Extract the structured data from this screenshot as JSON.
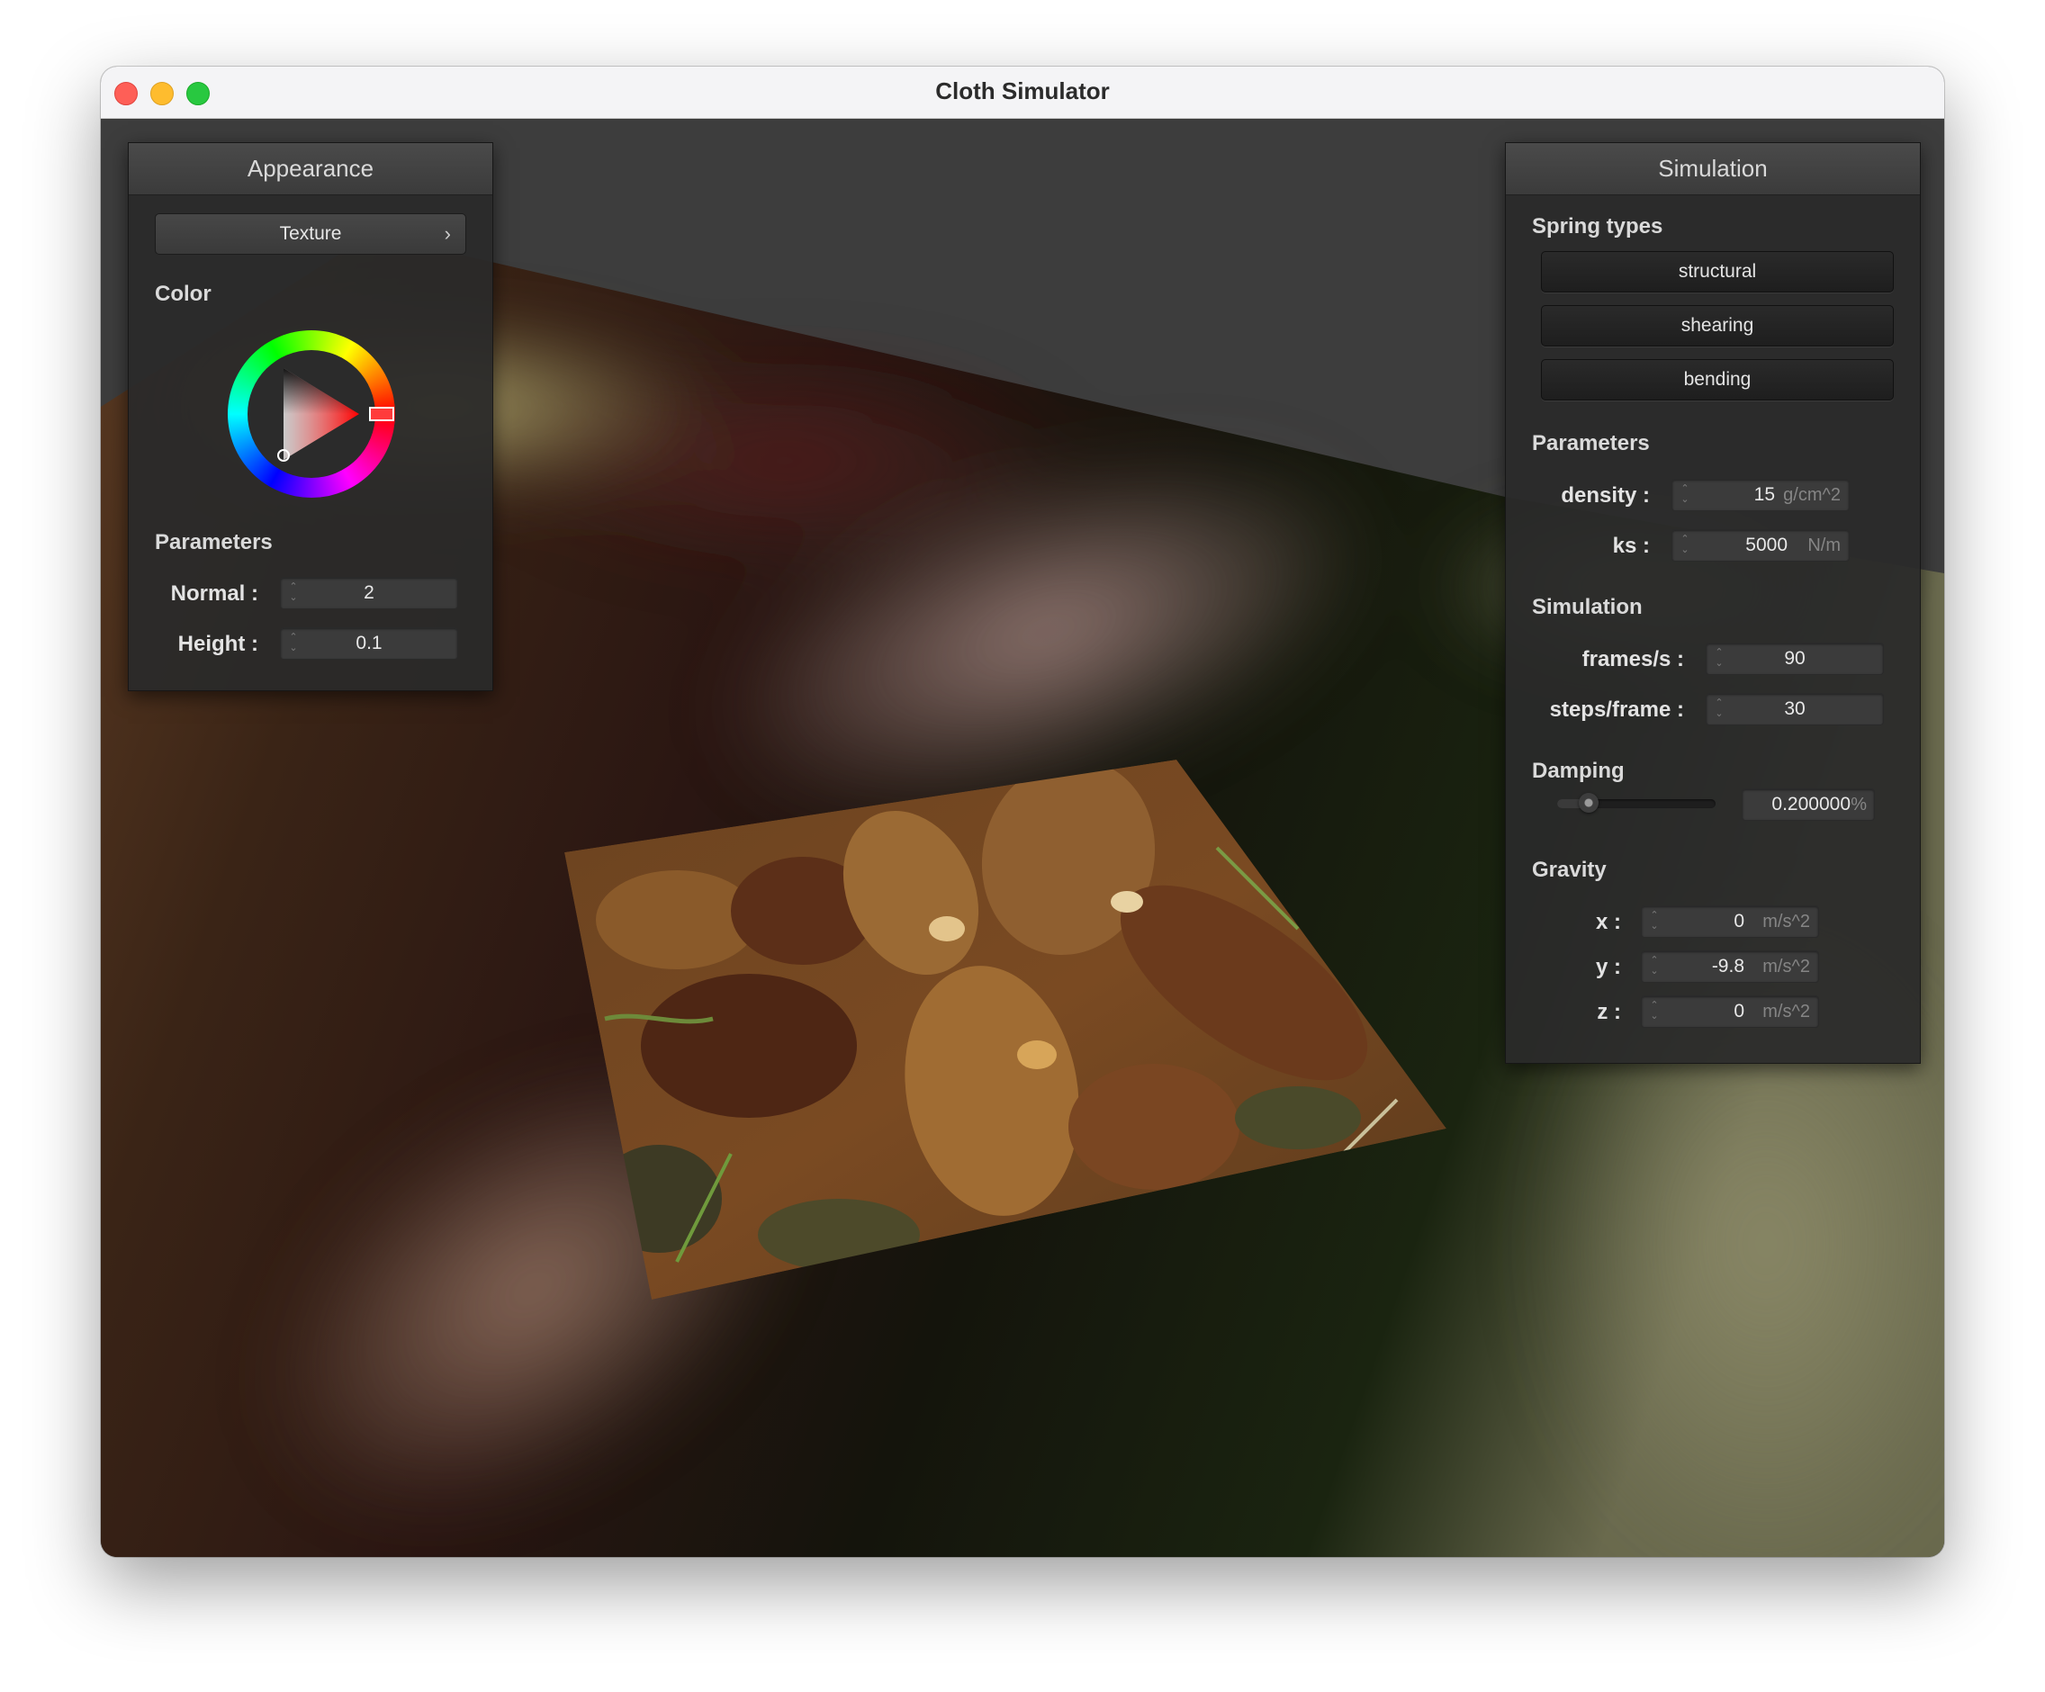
{
  "window": {
    "title": "Cloth Simulator"
  },
  "appearance": {
    "title": "Appearance",
    "texture_button": "Texture",
    "color_label": "Color",
    "color": "#ff0000",
    "parameters_label": "Parameters",
    "normal": {
      "label": "Normal :",
      "value": "2"
    },
    "height": {
      "label": "Height :",
      "value": "0.1"
    }
  },
  "simulation": {
    "title": "Simulation",
    "spring_types_label": "Spring types",
    "spring_buttons": [
      "structural",
      "shearing",
      "bending"
    ],
    "parameters_label": "Parameters",
    "density": {
      "label": "density :",
      "value": "15",
      "unit": "g/cm^2"
    },
    "ks": {
      "label": "ks :",
      "value": "5000",
      "unit": "N/m"
    },
    "sim_label": "Simulation",
    "frames": {
      "label": "frames/s :",
      "value": "90"
    },
    "steps": {
      "label": "steps/frame :",
      "value": "30"
    },
    "damping_label": "Damping",
    "damping": {
      "value": "0.200000",
      "unit": "%",
      "slider_fraction": 0.2
    },
    "gravity_label": "Gravity",
    "gx": {
      "label": "x :",
      "value": "0",
      "unit": "m/s^2"
    },
    "gy": {
      "label": "y :",
      "value": "-9.8",
      "unit": "m/s^2"
    },
    "gz": {
      "label": "z :",
      "value": "0",
      "unit": "m/s^2"
    }
  }
}
